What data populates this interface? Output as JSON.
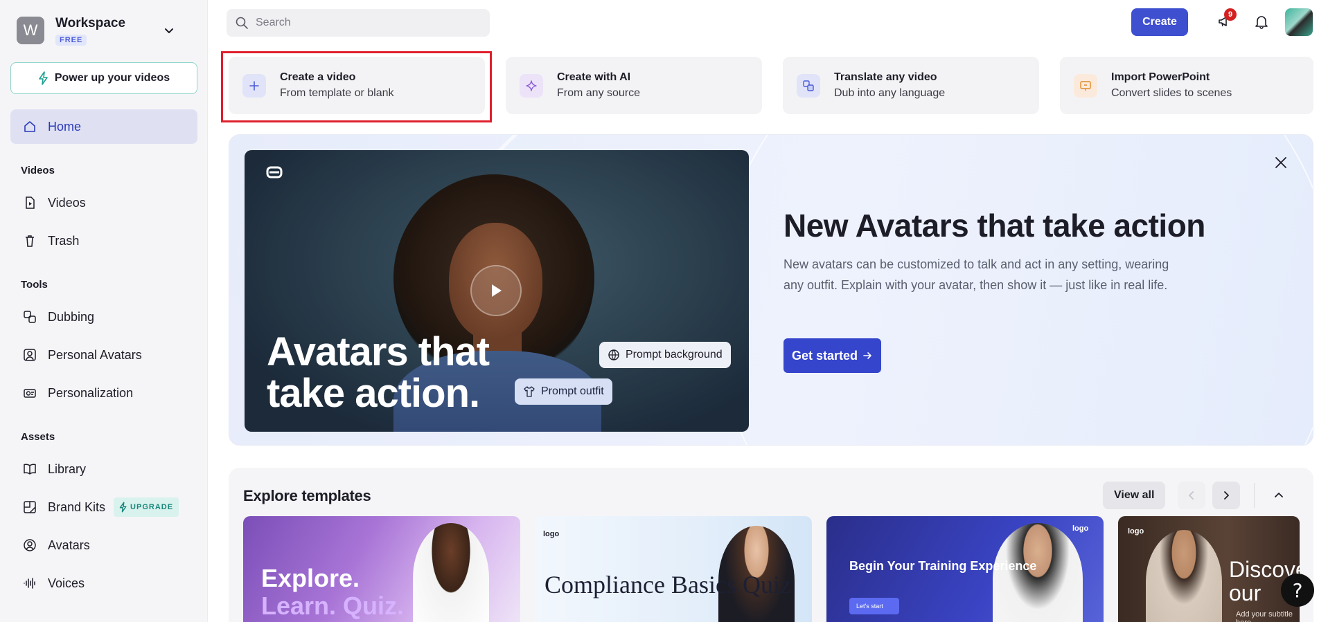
{
  "sidebar": {
    "workspace": {
      "initial": "W",
      "name": "Workspace",
      "plan": "FREE"
    },
    "power_up": "Power up your videos",
    "home": "Home",
    "sections": [
      {
        "title": "Videos",
        "items": [
          "Videos",
          "Trash"
        ]
      },
      {
        "title": "Tools",
        "items": [
          "Dubbing",
          "Personal Avatars",
          "Personalization"
        ]
      },
      {
        "title": "Assets",
        "items": [
          "Library",
          "Brand Kits",
          "Avatars",
          "Voices"
        ]
      }
    ],
    "upgrade_badge": "UPGRADE"
  },
  "topbar": {
    "search_placeholder": "Search",
    "create_label": "Create",
    "notification_count": "9"
  },
  "actions": [
    {
      "title": "Create a video",
      "subtitle": "From template or blank",
      "icon": "plus-icon",
      "color": "#4b5bd6"
    },
    {
      "title": "Create with AI",
      "subtitle": "From any source",
      "icon": "sparkle-icon",
      "color": "#8a5cd6"
    },
    {
      "title": "Translate any video",
      "subtitle": "Dub into any language",
      "icon": "translate-icon",
      "color": "#4b5bd6"
    },
    {
      "title": "Import PowerPoint",
      "subtitle": "Convert slides to scenes",
      "icon": "presentation-icon",
      "color": "#e08a2a"
    }
  ],
  "banner": {
    "video_headline": "Avatars that take action.",
    "pill_background": "Prompt background",
    "pill_outfit": "Prompt outfit",
    "title": "New Avatars that take action",
    "description": "New avatars can be customized to talk and act in any setting, wearing any outfit. Explain with your avatar, then show it — just like in real life.",
    "cta": "Get started"
  },
  "templates": {
    "title": "Explore templates",
    "view_all": "View all",
    "cards": [
      {
        "line1": "Explore.",
        "line2": "Learn. Quiz."
      },
      {
        "logo": "logo",
        "title": "Compliance Basics Quiz"
      },
      {
        "logo": "logo",
        "title": "Begin Your Training Experience",
        "button": "Let's start"
      },
      {
        "logo": "logo",
        "title": "Discover our",
        "subtitle": "Add your subtitle here"
      }
    ]
  },
  "colors": {
    "accent": "#3e4fd0",
    "highlight": "#e01e2b",
    "upgrade": "#18857a"
  }
}
